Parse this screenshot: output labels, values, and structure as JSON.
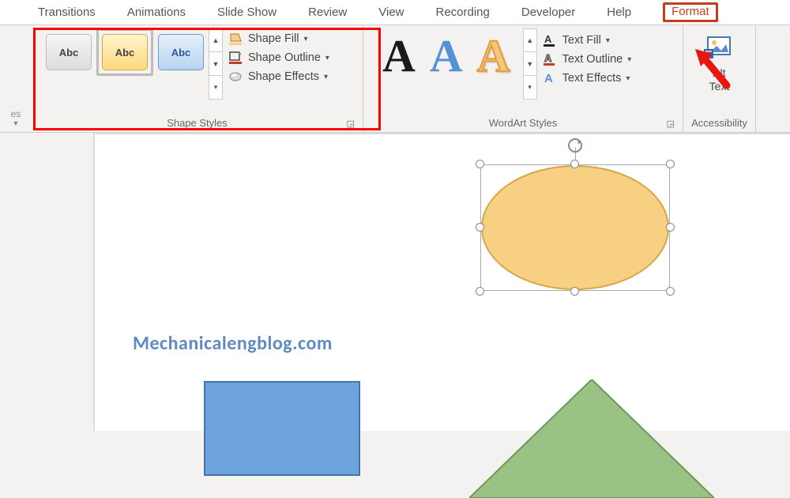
{
  "tabs": {
    "transitions": "Transitions",
    "animations": "Animations",
    "slideshow": "Slide Show",
    "review": "Review",
    "view": "View",
    "recording": "Recording",
    "developer": "Developer",
    "help": "Help",
    "format": "Format"
  },
  "truncated_group": "es",
  "shape_styles": {
    "thumb_label": "Abc",
    "fill": "Shape Fill",
    "outline": "Shape Outline",
    "effects": "Shape Effects",
    "group_label": "Shape Styles"
  },
  "wordart": {
    "sample": "A",
    "text_fill": "Text Fill",
    "text_outline": "Text Outline",
    "text_effects": "Text Effects",
    "group_label": "WordArt Styles"
  },
  "accessibility": {
    "alt_text": "Alt\nText",
    "alt_text_line1": "Alt",
    "alt_text_line2": "Text",
    "group_label": "Accessibility"
  },
  "watermark": "Mechanicalengblog.com",
  "colors": {
    "accent": "#c43e1c",
    "ellipse_fill": "#f8d084",
    "ellipse_stroke": "#d7a64a",
    "rect_fill": "#6da3dc",
    "rect_stroke": "#4475a8",
    "tri_fill": "#9bc285",
    "tri_stroke": "#6b9a58"
  }
}
